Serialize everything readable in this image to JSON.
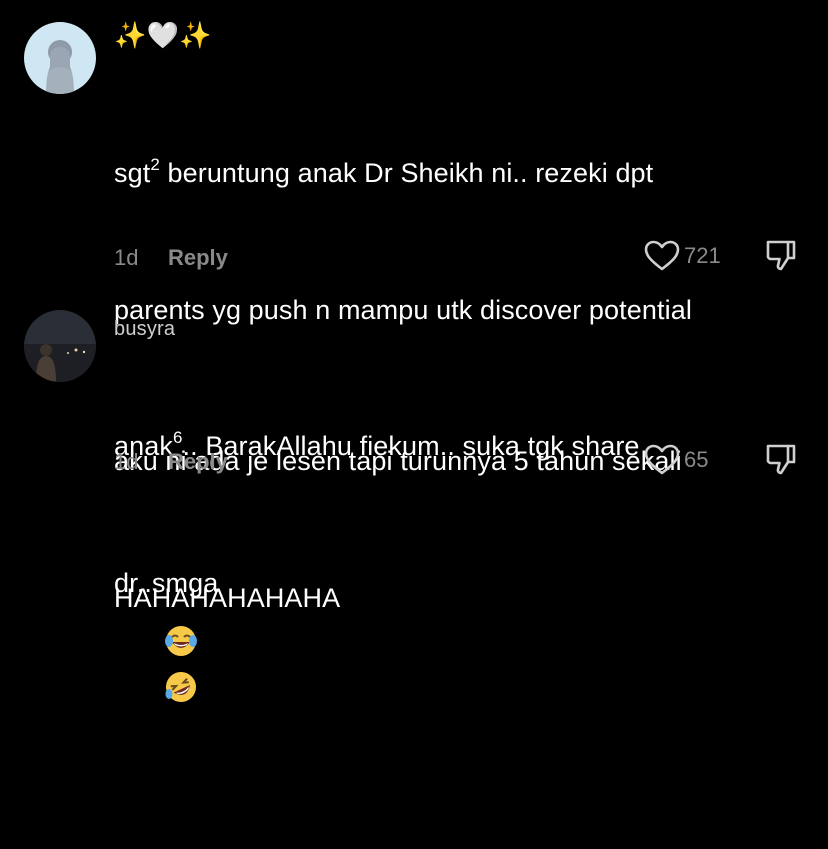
{
  "comments": [
    {
      "username": "✨🤍✨",
      "text_line1_a": "sgt",
      "text_line1_sup": "2",
      "text_line1_b": " beruntung anak Dr Sheikh ni.. rezeki dpt",
      "text_line2": "parents yg push n mampu utk discover potential",
      "text_line3_a": "anak",
      "text_line3_sup": "6",
      "text_line3_b": ".. BarakAllahu fiekum.. suka tgk share",
      "text_line4": "dr..smga",
      "time": "1d",
      "reply_label": "Reply",
      "likes": "721"
    },
    {
      "username": "busyra",
      "text_line1": "aku ni ada je lesen tapi turunnya 5 tahun sekali",
      "text_line2": "HAHAHAHAHAHA",
      "time": "1d",
      "reply_label": "Reply",
      "likes": "65",
      "emojis": [
        "face-with-tears-of-joy",
        "rolling-on-the-floor-laughing"
      ]
    }
  ],
  "colors": {
    "background": "#000000",
    "text": "#ffffff",
    "muted": "#8a8a8a"
  }
}
